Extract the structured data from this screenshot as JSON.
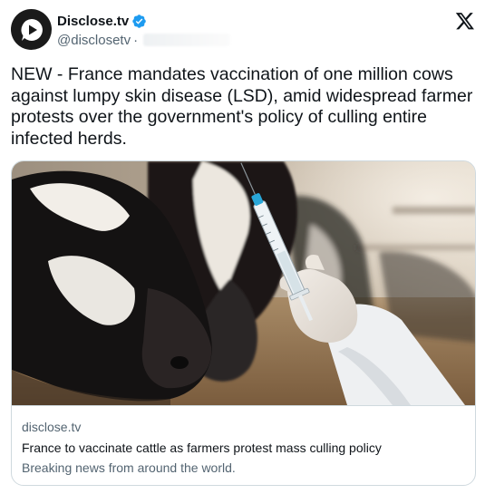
{
  "author": {
    "display_name": "Disclose.tv",
    "handle": "@disclosetv",
    "separator": "·",
    "avatar_icon": "disclose-logo-icon",
    "verified_icon": "verified-badge-icon",
    "verified_color": "#1d9bf0"
  },
  "platform": {
    "logo_icon": "x-logo-icon"
  },
  "tweet": {
    "text": "NEW - France mandates vaccination of one million cows\nagainst lumpy skin disease (LSD), amid widespread farmer\nprotests over the government's policy of culling entire\ninfected herds."
  },
  "link_card": {
    "image_alt": "Dairy cows in a barn with a gloved hand holding a vaccine syringe",
    "domain": "disclose.tv",
    "title": "France to vaccinate cattle as farmers protest mass culling policy",
    "description": "Breaking news from around the world."
  },
  "colors": {
    "text_primary": "#0f1419",
    "text_secondary": "#536471",
    "border": "#cfd9de"
  }
}
